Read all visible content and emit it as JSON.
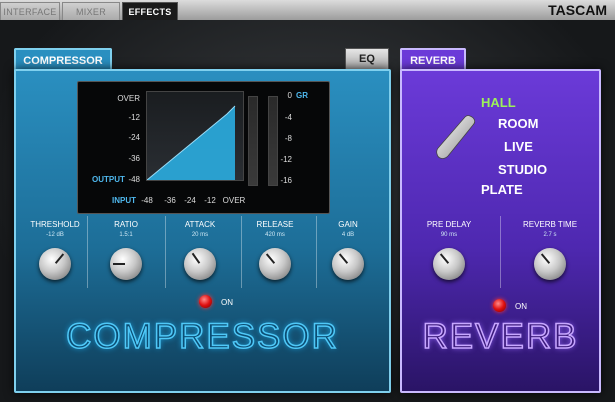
{
  "tabs": [
    {
      "label": "INTERFACE",
      "active": false
    },
    {
      "label": "MIXER",
      "active": false
    },
    {
      "label": "EFFECTS",
      "active": true
    }
  ],
  "brand": "TASCAM",
  "compressor": {
    "tab_label": "COMPRESSOR",
    "eq_tab_label": "EQ",
    "display": {
      "output_ticks": [
        "OVER",
        "-12",
        "-24",
        "-36",
        "-48"
      ],
      "output_label": "OUTPUT",
      "input_label": "INPUT",
      "input_ticks": [
        "-48",
        "-36",
        "-24",
        "-12",
        "OVER"
      ],
      "gr_label": "GR",
      "gr_ticks": [
        "0",
        "-4",
        "-8",
        "-12",
        "-16"
      ]
    },
    "knobs": [
      {
        "label": "THRESHOLD",
        "value": "-12 dB",
        "angle": 40
      },
      {
        "label": "RATIO",
        "value": "1.5:1",
        "angle": -90
      },
      {
        "label": "ATTACK",
        "value": "20 ms",
        "angle": -35
      },
      {
        "label": "RELEASE",
        "value": "420 ms",
        "angle": -40
      },
      {
        "label": "GAIN",
        "value": "4 dB",
        "angle": -40
      }
    ],
    "on_label": "ON",
    "big_label": "COMPRESSOR"
  },
  "reverb": {
    "tab_label": "REVERB",
    "types": [
      "HALL",
      "ROOM",
      "LIVE",
      "STUDIO",
      "PLATE"
    ],
    "selected_type": "HALL",
    "knobs": [
      {
        "label": "PRE DELAY",
        "value": "90 ms",
        "angle": -40
      },
      {
        "label": "REVERB TIME",
        "value": "2.7 s",
        "angle": -40
      }
    ],
    "on_label": "ON",
    "big_label": "REVERB"
  },
  "colors": {
    "compressor_accent": "#4fc8f7",
    "reverb_accent": "#c7a7ff",
    "selected_type": "#9cf25a",
    "led_on": "#e01010"
  }
}
